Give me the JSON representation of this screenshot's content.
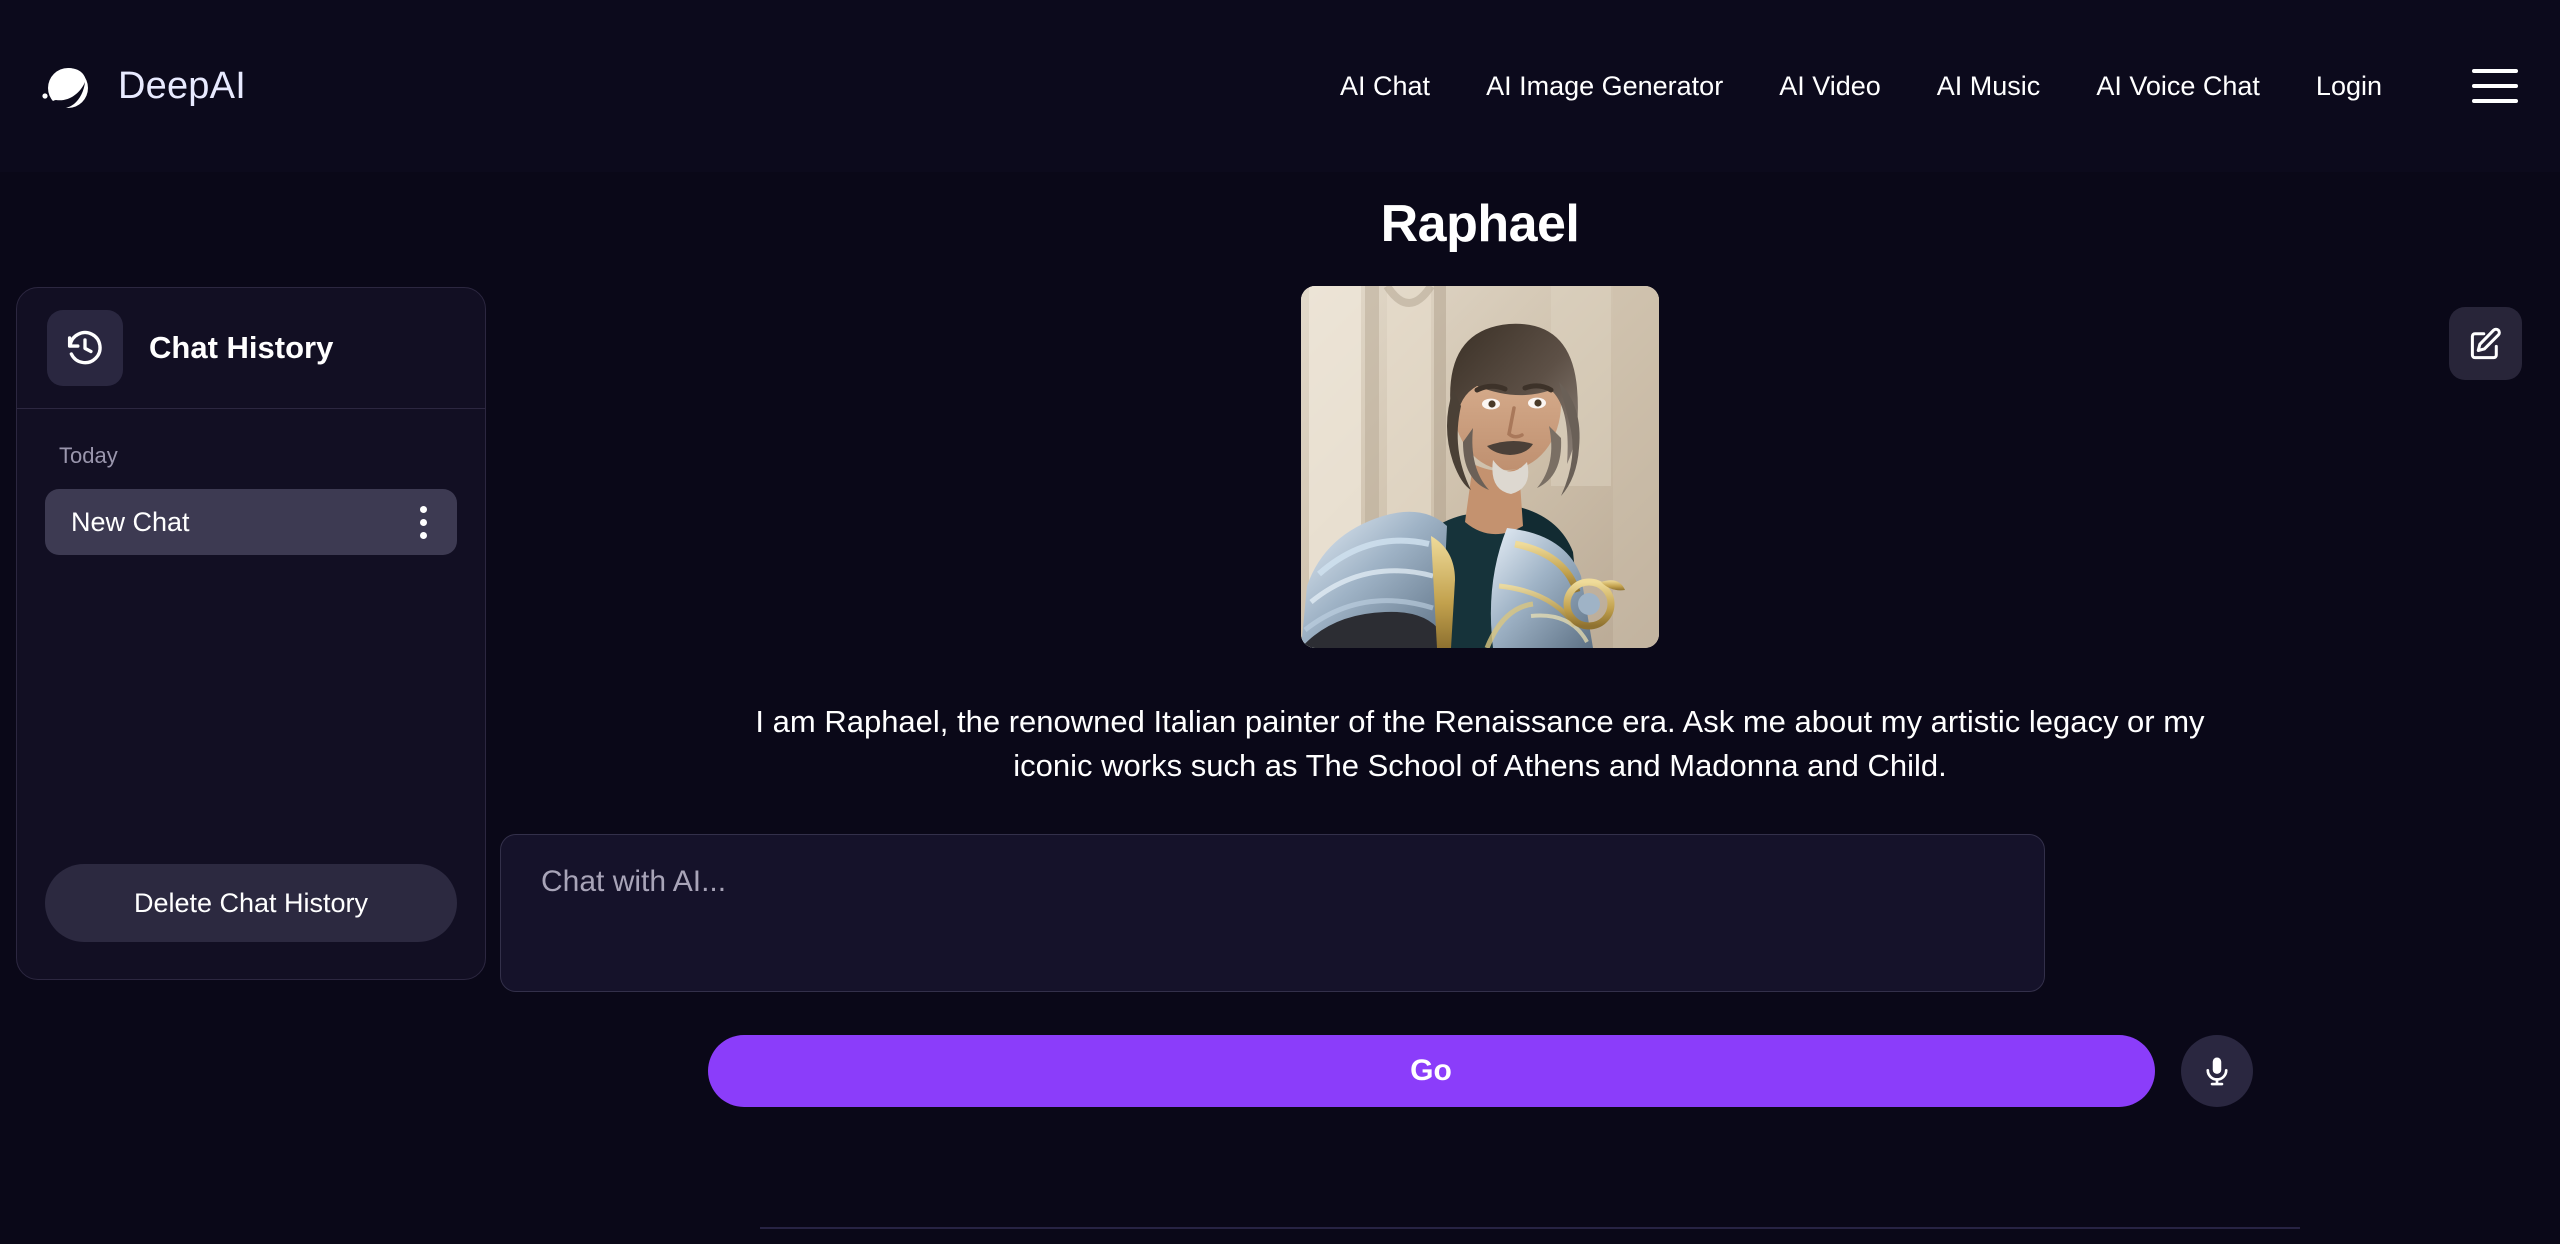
{
  "brand": {
    "name": "DeepAI",
    "logo_icon": "dolphin-logo-icon"
  },
  "nav": {
    "items": [
      {
        "label": "AI Chat"
      },
      {
        "label": "AI Image Generator"
      },
      {
        "label": "AI Video"
      },
      {
        "label": "AI Music"
      },
      {
        "label": "AI Voice Chat"
      },
      {
        "label": "Login"
      }
    ],
    "menu_icon": "hamburger-menu-icon"
  },
  "sidebar": {
    "title": "Chat History",
    "title_icon": "history-clock-icon",
    "group_label": "Today",
    "chats": [
      {
        "label": "New Chat",
        "menu_icon": "more-vertical-icon"
      }
    ],
    "delete_label": "Delete Chat History"
  },
  "main": {
    "title": "Raphael",
    "avatar_alt": "Raphael portrait in silver and gold armor",
    "description": "I am Raphael, the renowned Italian painter of the Renaissance era. Ask me about my artistic legacy or my iconic works such as The School of Athens and Madonna and Child.",
    "input_placeholder": "Chat with AI...",
    "input_value": "",
    "go_label": "Go",
    "mic_icon": "microphone-icon",
    "edit_icon": "edit-compose-icon"
  },
  "colors": {
    "page_background": "#0a0818",
    "header_background": "#0c0a1c",
    "accent": "#8b3dfa",
    "panel": "#120f23",
    "panel_border": "#2c2740",
    "chat_item_active": "#3d3a52"
  }
}
